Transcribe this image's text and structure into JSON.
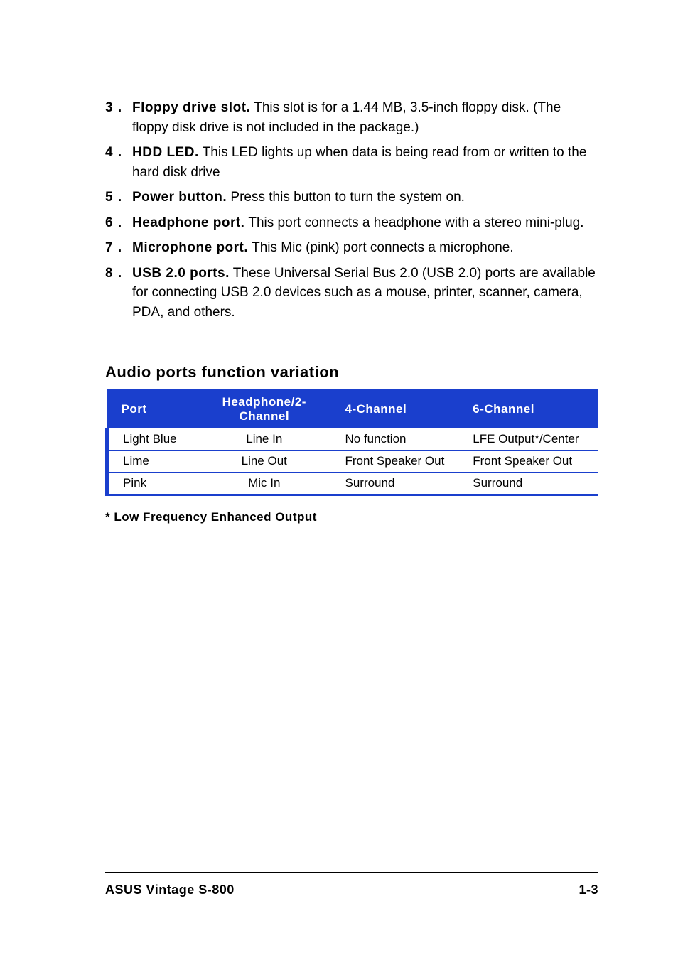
{
  "items": [
    {
      "num": "3 .",
      "lead": "Floppy drive slot.",
      "text": " This slot is for a 1.44 MB, 3.5-inch floppy disk. (The floppy disk drive is not included in the package.)"
    },
    {
      "num": "4 .",
      "lead": "HDD LED.",
      "text": " This LED lights up when data is being read from or written to the hard disk drive"
    },
    {
      "num": "5 .",
      "lead": "Power button.",
      "text": " Press this button to turn the system on."
    },
    {
      "num": "6 .",
      "lead": "Headphone port.",
      "text": " This port connects a headphone with a stereo mini-plug."
    },
    {
      "num": "7 .",
      "lead": "Microphone port.",
      "text": " This Mic (pink) port connects a microphone."
    },
    {
      "num": "8 .",
      "lead": "USB 2.0 ports.",
      "text": " These Universal Serial Bus 2.0 (USB 2.0) ports are available for connecting USB 2.0 devices such as a mouse, printer, scanner, camera, PDA, and others."
    }
  ],
  "section_title": "Audio ports function variation",
  "table": {
    "headers": [
      "Port",
      "Headphone/2-Channel",
      "4-Channel",
      "6-Channel"
    ],
    "rows": [
      [
        "Light Blue",
        "Line In",
        "No function",
        "LFE Output*/Center"
      ],
      [
        "Lime",
        "Line Out",
        "Front Speaker Out",
        "Front Speaker Out"
      ],
      [
        "Pink",
        "Mic In",
        "Surround",
        "Surround"
      ]
    ]
  },
  "footnote": "* Low Frequency Enhanced Output",
  "footer": {
    "left": "ASUS Vintage S-800",
    "right": "1-3"
  }
}
